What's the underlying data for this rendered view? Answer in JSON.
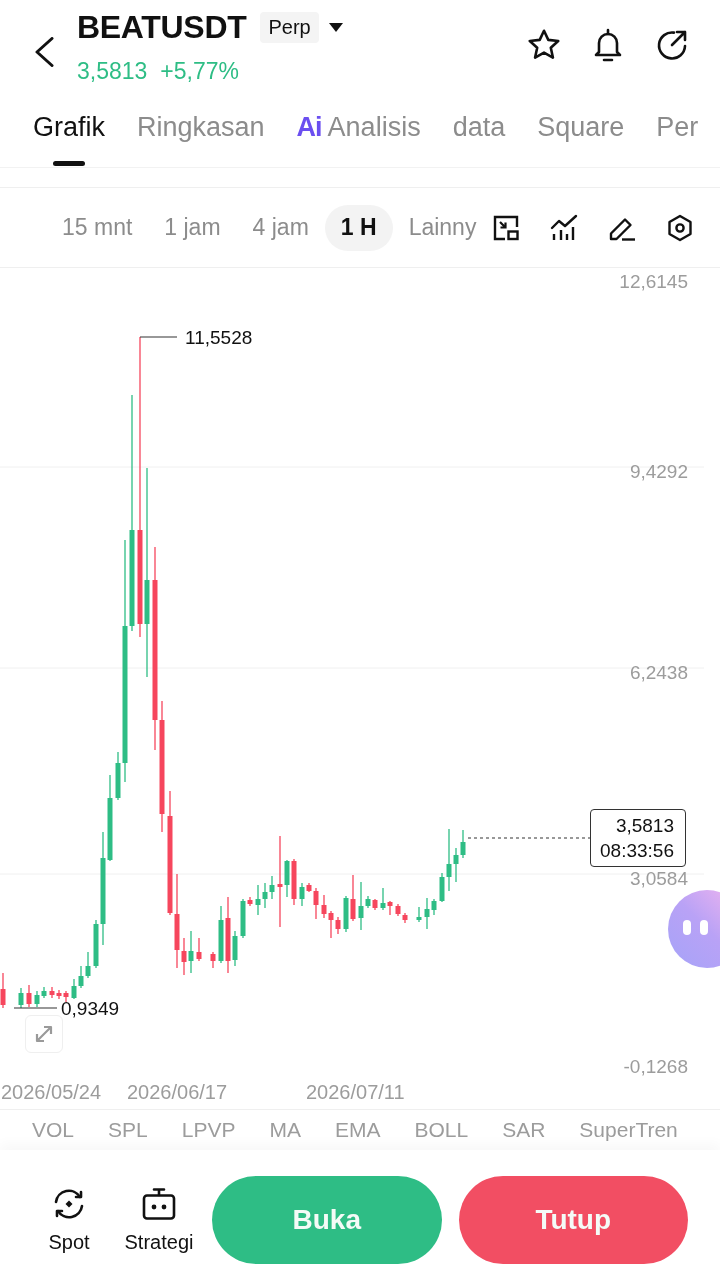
{
  "header": {
    "symbol": "BEATUSDT",
    "contract_type": "Perp",
    "price": "3,5813",
    "change": "+5,77%"
  },
  "tabs": [
    {
      "label": "Grafik",
      "kind": "plain",
      "selected": true
    },
    {
      "label": "Ringkasan",
      "kind": "plain",
      "selected": false
    },
    {
      "label": "Analisis",
      "prefix": "Ai",
      "kind": "ai",
      "selected": false
    },
    {
      "label": "data",
      "kind": "plain",
      "selected": false
    },
    {
      "label": "Square",
      "kind": "plain",
      "selected": false
    },
    {
      "label": "Per",
      "kind": "plain",
      "selected": false
    }
  ],
  "timeframes": [
    {
      "label": "15 mnt",
      "selected": false
    },
    {
      "label": "1 jam",
      "selected": false
    },
    {
      "label": "4 jam",
      "selected": false
    },
    {
      "label": "1 H",
      "selected": true
    },
    {
      "label": "Lainny",
      "selected": false
    }
  ],
  "chart": {
    "price_axis": [
      "12,6145",
      "9,4292",
      "6,2438",
      "3,0584",
      "-0,1268"
    ],
    "date_axis": [
      "2026/05/24",
      "2026/06/17",
      "2026/07/11"
    ],
    "high_label": "11,5528",
    "low_label": "0,9349",
    "last_price": "3,5813",
    "countdown": "08:33:56"
  },
  "indicators": [
    "VOL",
    "SPL",
    "LPVP",
    "MA",
    "EMA",
    "BOLL",
    "SAR",
    "SuperTren"
  ],
  "bottom_bar": {
    "shortcuts": [
      {
        "label": "Spot",
        "kind": "spot"
      },
      {
        "label": "Strategi",
        "kind": "strategy"
      }
    ],
    "buttons": [
      {
        "label": "Buka",
        "kind": "open"
      },
      {
        "label": "Tutup",
        "kind": "close"
      }
    ]
  }
}
